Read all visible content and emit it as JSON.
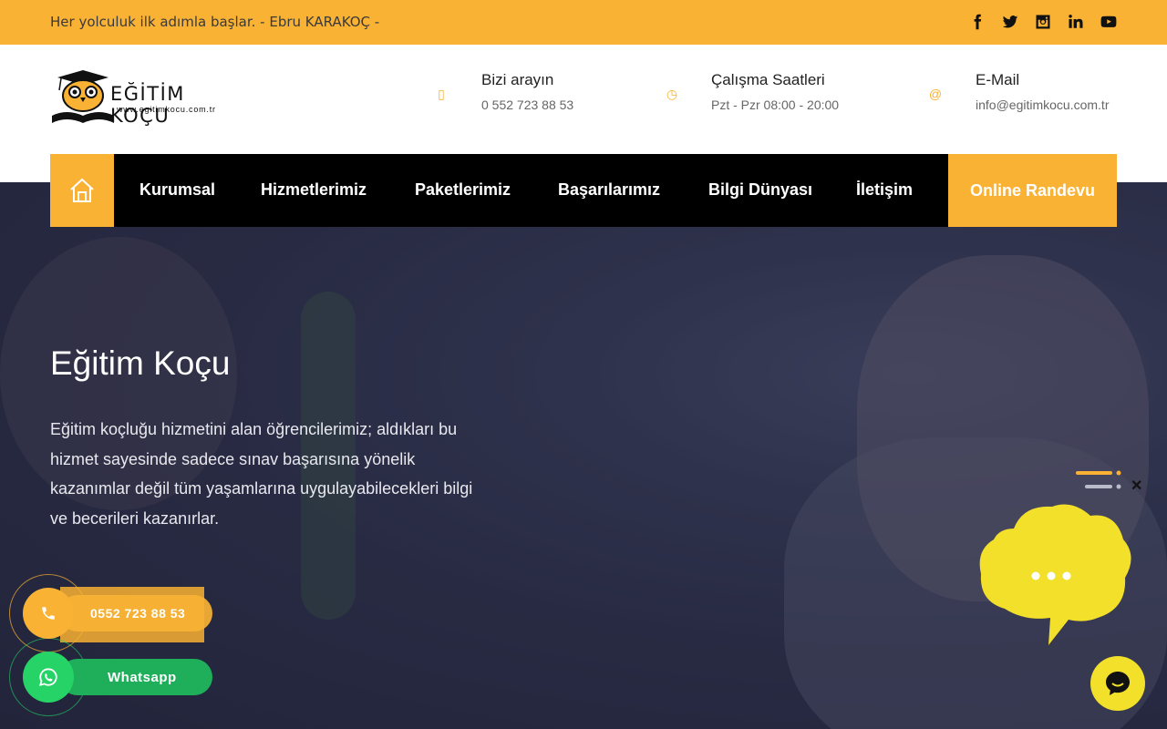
{
  "topbar": {
    "quote": "Her yolculuk ilk adımla başlar. - Ebru KARAKOÇ -",
    "socials": [
      "facebook-icon",
      "twitter-icon",
      "instagram-icon",
      "linkedin-icon",
      "youtube-icon"
    ]
  },
  "header": {
    "logo_title": "EĞİTİM KOÇU",
    "logo_url": "www.egitimkocu.com.tr",
    "phone": {
      "label": "Bizi arayın",
      "value": "0 552 723 88 53"
    },
    "hours": {
      "label": "Çalışma Saatleri",
      "value": "Pzt - Pzr 08:00 - 20:00"
    },
    "email": {
      "label": "E-Mail",
      "value": "info@egitimkocu.com.tr"
    }
  },
  "nav": {
    "items": [
      "Kurumsal",
      "Hizmetlerimiz",
      "Paketlerimiz",
      "Başarılarımız",
      "Bilgi Dünyası",
      "İletişim"
    ],
    "cta": "Online Randevu"
  },
  "hero": {
    "title": "Eğitim Koçu",
    "description": "Eğitim koçluğu hizmetini alan öğrencilerimiz; aldıkları bu hizmet sayesinde sadece sınav başarısına yönelik kazanımlar değil tüm yaşamlarına uygulayabilecekleri bilgi ve becerileri kazanırlar."
  },
  "floating": {
    "call_number": "0552 723 88 53",
    "whatsapp_label": "Whatsapp"
  },
  "colors": {
    "accent": "#f9b233",
    "whatsapp": "#25d366",
    "chat": "#f2e02a"
  }
}
